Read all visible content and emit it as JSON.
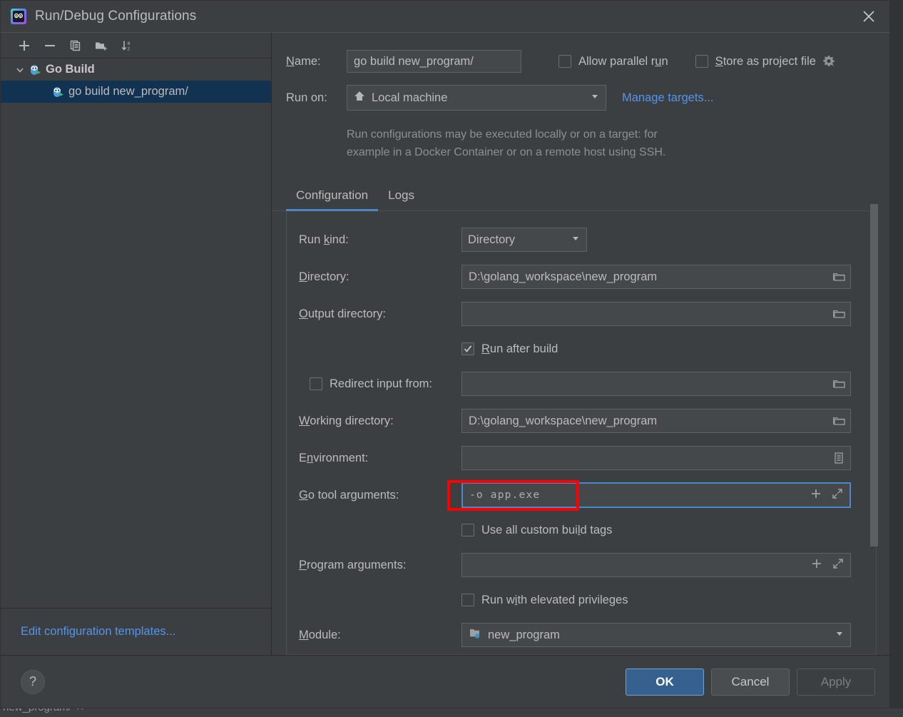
{
  "window": {
    "title": "Run/Debug Configurations",
    "app_icon": "goland-icon",
    "close_icon": "close-icon"
  },
  "sidebar": {
    "toolbar": [
      {
        "name": "add-configuration-button",
        "icon": "plus-icon"
      },
      {
        "name": "remove-configuration-button",
        "icon": "minus-icon"
      },
      {
        "name": "copy-configuration-button",
        "icon": "copy-icon"
      },
      {
        "name": "new-folder-button",
        "icon": "new-folder-icon"
      },
      {
        "name": "sort-configurations-button",
        "icon": "sort-alpha-icon"
      }
    ],
    "tree": [
      {
        "label": "Go Build",
        "type": "group",
        "icon": "go-gopher-icon",
        "expanded": true,
        "selected": false
      },
      {
        "label": "go build new_program/",
        "type": "item",
        "icon": "go-gopher-icon",
        "selected": true
      }
    ],
    "edit_templates_link": "Edit configuration templates..."
  },
  "form": {
    "name_label": "Name:",
    "name_value": "go build new_program/",
    "allow_parallel_run": {
      "label": "Allow parallel run",
      "checked": false
    },
    "store_as_project_file": {
      "label": "Store as project file",
      "checked": false,
      "gear_icon": "gear-dropdown-icon"
    },
    "run_on_label": "Run on:",
    "run_on_value": "Local machine",
    "run_on_icon": "home-icon",
    "manage_targets_link": "Manage targets...",
    "hint_line1": "Run configurations may be executed locally or on a target: for",
    "hint_line2": "example in a Docker Container or on a remote host using SSH."
  },
  "tabs": [
    {
      "label": "Configuration",
      "active": true
    },
    {
      "label": "Logs",
      "active": false
    }
  ],
  "configuration": {
    "run_kind": {
      "label": "Run kind:",
      "value": "Directory"
    },
    "directory": {
      "label": "Directory:",
      "value": "D:\\golang_workspace\\new_program",
      "icon": "folder-browse-icon"
    },
    "output_directory": {
      "label": "Output directory:",
      "value": "",
      "icon": "folder-browse-icon"
    },
    "run_after_build": {
      "label": "Run after build",
      "checked": true
    },
    "redirect_input_from": {
      "label": "Redirect input from:",
      "checked": false,
      "value": "",
      "icon": "folder-browse-icon"
    },
    "working_directory": {
      "label": "Working directory:",
      "value": "D:\\golang_workspace\\new_program",
      "icon": "folder-browse-icon"
    },
    "environment": {
      "label": "Environment:",
      "value": "",
      "icon": "environment-list-icon"
    },
    "go_tool_arguments": {
      "label": "Go tool arguments:",
      "value": "-o app.exe",
      "focused": true,
      "highlighted": true,
      "add_icon": "plus-icon",
      "expand_icon": "expand-arrows-icon"
    },
    "use_all_custom_build_tags": {
      "label": "Use all custom build tags",
      "checked": false
    },
    "program_arguments": {
      "label": "Program arguments:",
      "value": "",
      "add_icon": "plus-icon",
      "expand_icon": "expand-arrows-icon"
    },
    "run_with_elevated_privileges": {
      "label": "Run with elevated privileges",
      "checked": false
    },
    "module": {
      "label": "Module:",
      "value": "new_program",
      "icon": "module-folder-icon"
    }
  },
  "footer": {
    "help_label": "?",
    "ok_label": "OK",
    "cancel_label": "Cancel",
    "apply_label": "Apply"
  },
  "background": {
    "editor_tab_text": "new_program/"
  },
  "colors": {
    "accent_blue": "#4a88c7",
    "link_blue": "#5394ec",
    "selection_blue": "#123252",
    "annotation_red": "#ff0000",
    "ok_button_blue": "#36618e",
    "panel_bg": "#3c3f41",
    "field_bg": "#45484a"
  }
}
